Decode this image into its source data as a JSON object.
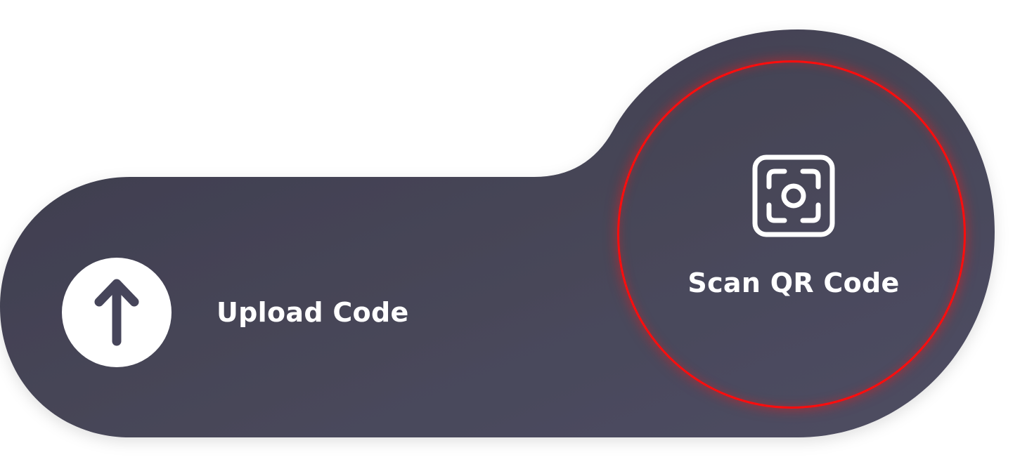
{
  "colors": {
    "background": "#ffffff",
    "panel": "#46455a",
    "highlight_ring": "#ff0d0d",
    "foreground": "#ffffff"
  },
  "upload": {
    "label": "Upload Code",
    "icon": "arrow-up-icon"
  },
  "scan": {
    "label": "Scan QR Code",
    "icon": "camera-viewfinder-icon"
  }
}
